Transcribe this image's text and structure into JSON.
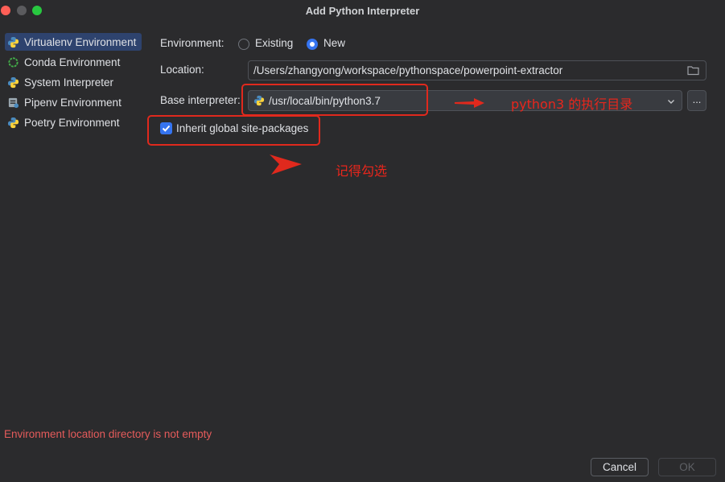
{
  "window": {
    "title": "Add Python Interpreter"
  },
  "sidebar": {
    "items": [
      {
        "label": "Virtualenv Environment",
        "icon": "python-icon",
        "selected": true
      },
      {
        "label": "Conda Environment",
        "icon": "conda-icon",
        "selected": false
      },
      {
        "label": "System Interpreter",
        "icon": "python-icon",
        "selected": false
      },
      {
        "label": "Pipenv Environment",
        "icon": "pipenv-icon",
        "selected": false
      },
      {
        "label": "Poetry Environment",
        "icon": "python-icon",
        "selected": false
      }
    ]
  },
  "form": {
    "environment_label": "Environment:",
    "existing_label": "Existing",
    "new_label": "New",
    "environment_selected": "New",
    "location_label": "Location:",
    "location_value": "/Users/zhangyong/workspace/pythonspace/powerpoint-extractor",
    "base_interpreter_label": "Base interpreter:",
    "base_interpreter_value": "/usr/local/bin/python3.7",
    "browse_label": "...",
    "inherit_label": "Inherit global site-packages",
    "inherit_checked": true
  },
  "annotations": {
    "arrow_note": "python3 的执行目录",
    "check_note": "记得勾选",
    "color": "#e0291d"
  },
  "error": {
    "message": "Environment location directory is not empty"
  },
  "footer": {
    "cancel_label": "Cancel",
    "ok_label": "OK"
  },
  "colors": {
    "accent": "#3574f0",
    "selection": "#2e436e",
    "error": "#e55b5b",
    "background": "#2b2b2d"
  }
}
